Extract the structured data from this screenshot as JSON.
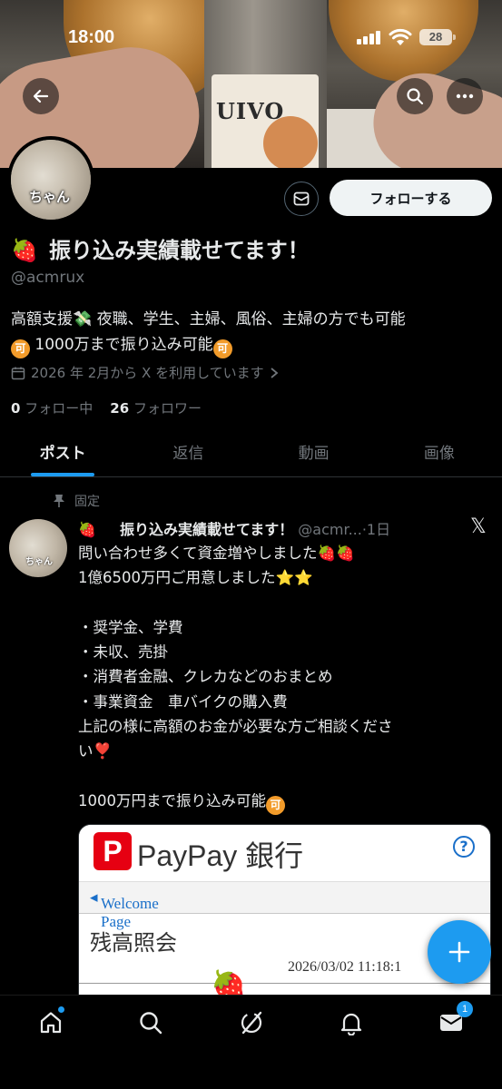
{
  "status_bar": {
    "time": "18:00",
    "battery": "28"
  },
  "header": {
    "back_icon": "arrow-left-icon",
    "search_icon": "search-icon",
    "more_icon": "more-horizontal-icon"
  },
  "banner": {
    "bottle_label": "UIVO"
  },
  "profile": {
    "avatar_sticker": "ちゃん",
    "name_emoji": "🍓",
    "name": "振り込み実績載せてます！",
    "handle": "@acmrux",
    "bio_line1": "高額支援💸 夜職、学生、主婦、風俗、主婦の方でも可能",
    "bio_badge": "可",
    "bio_line2": " 1000万まで振り込み可能",
    "joined": "2026 年 2月から X を利用しています",
    "following_count": "0",
    "following_label": " フォロー中",
    "followers_count": "26",
    "followers_label": " フォロワー",
    "message_button": "envelope-icon",
    "follow_button": "フォローする"
  },
  "tabs": [
    {
      "label": "ポスト",
      "active": true
    },
    {
      "label": "返信",
      "active": false
    },
    {
      "label": "動画",
      "active": false
    },
    {
      "label": "画像",
      "active": false
    }
  ],
  "post": {
    "pinned_label": "固定",
    "avatar_sticker": "ちゃん",
    "name_emoji": "🍓",
    "name": "振り込み実績載せてます！",
    "handle_time": " @acmr...·1日",
    "x_logo": "𝕏",
    "body": "問い合わせ多くて資金増やしました🍓🍓\n1億6500万円ご用意しました⭐⭐\n\n・奨学金、学費\n・未収、売掛\n・消費者金融、クレカなどのおまとめ\n・事業資金　車バイクの購入費\n上記の様に高額のお金が必要な方ご相談くださ\nい❣️\n\n1000万円まで振り込み可能",
    "body_badge": "可",
    "embed": {
      "logo_letter": "P",
      "brand": "PayPay 銀行",
      "help": "?",
      "nav_link": "Welcome Page",
      "title": "残高照会",
      "date": "2026/03/02 11:18:1",
      "berry": "🍓"
    }
  },
  "fab_icon": "plus-icon",
  "bottom_nav": {
    "items": [
      "home-icon",
      "search-icon",
      "grok-icon",
      "bell-icon",
      "mail-icon"
    ],
    "mail_badge": "1"
  },
  "colors": {
    "accent": "#1d9bf0",
    "background": "#000000",
    "muted": "#71767b",
    "badge": "#f29b2a"
  }
}
